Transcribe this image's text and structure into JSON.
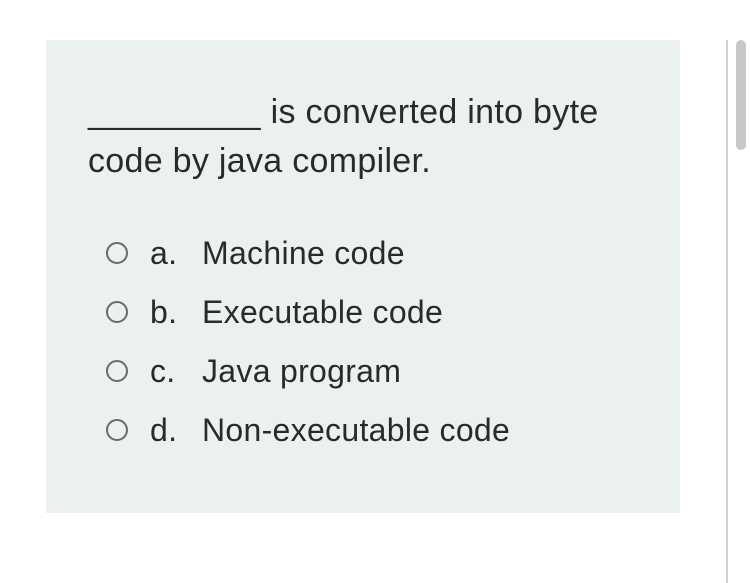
{
  "question": {
    "text": "_________ is converted into byte code by java compiler.",
    "options": [
      {
        "letter": "a.",
        "text": "Machine code"
      },
      {
        "letter": "b.",
        "text": "Executable code"
      },
      {
        "letter": "c.",
        "text": "Java program"
      },
      {
        "letter": "d.",
        "text": "Non-executable code"
      }
    ]
  }
}
